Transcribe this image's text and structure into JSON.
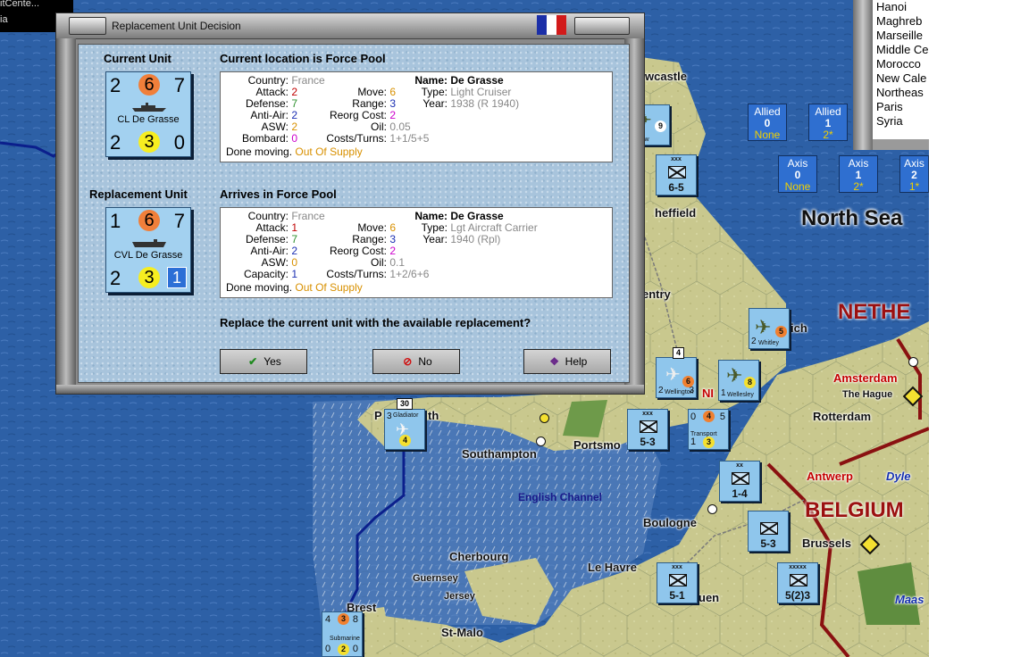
{
  "top_left": {
    "line1": "itCente...",
    "line2": "ia"
  },
  "right_list": {
    "items": [
      "Hanoi",
      "Maghreb",
      "Marseille",
      "Middle Ce",
      "Morocco",
      "New Cale",
      "Northeas",
      "Paris",
      "Syria"
    ]
  },
  "supply_boxes": [
    {
      "title": "Allied",
      "value": "0",
      "sub": "None"
    },
    {
      "title": "Allied",
      "value": "1",
      "sub": "2*"
    },
    {
      "title": "Axis",
      "value": "0",
      "sub": "None"
    },
    {
      "title": "Axis",
      "value": "1",
      "sub": "2*"
    },
    {
      "title": "Axis",
      "value": "2",
      "sub": "1*"
    }
  ],
  "map_labels": {
    "newcastle": "wcastle",
    "sheffield": "heffield",
    "coventry": "entry",
    "north_sea": "North Sea",
    "netherlands": "NETHE",
    "norwich": "ich",
    "amsterdam": "Amsterdam",
    "the_hague": "The Hague",
    "rotterdam": "Rotterdam",
    "plymouth_a": "P",
    "plymouth_b": "th",
    "southampton": "Southampton",
    "portsmouth": "Portsmo",
    "english_channel": "English Channel",
    "antwerp": "Antwerp",
    "dyle": "Dyle",
    "belgium": "BELGIUM",
    "boulogne": "Boulogne",
    "brussels": "Brussels",
    "cherbourg": "Cherbourg",
    "guernsey": "Guernsey",
    "jersey": "Jersey",
    "le_havre": "Le Havre",
    "rouen": "uen",
    "brest": "Brest",
    "st_malo": "St-Malo",
    "maas": "Maas",
    "ni": "NI"
  },
  "map_counters": [
    {
      "id": "c1",
      "top": "xxx",
      "val": "6-5"
    },
    {
      "id": "c2",
      "top": "xxx",
      "val": "5-3"
    },
    {
      "id": "c3",
      "top": "xx",
      "val": "1-4"
    },
    {
      "id": "c4",
      "top": "",
      "val": "5-3"
    },
    {
      "id": "c5",
      "top": "xxx",
      "val": "5-1"
    },
    {
      "id": "c6",
      "top": "xxxxx",
      "val": "5(2)3"
    }
  ],
  "map_air": {
    "whitley_name": "Whitley",
    "whitley_a": "2",
    "whitley_b": "5",
    "wellington_name": "Wellington",
    "wellington_a": "2",
    "wellington_b": "6",
    "wellington_c": "3",
    "wellesley_name": "Wellesley",
    "wellesley_a": "1",
    "wellesley_b": "8",
    "gladiator_name": "Gladiator",
    "gladiator_a": "3",
    "gladiator_b": "4",
    "arrow_name": "rrow",
    "arrow_b": "9",
    "stack4": "4",
    "stack30": "30"
  },
  "transport": {
    "name": "Transport",
    "a": "0",
    "b": "4",
    "c": "5",
    "d": "1",
    "e": "3"
  },
  "submarine": {
    "name": "Submarine",
    "a": "4",
    "b": "3",
    "c": "8",
    "d": "0",
    "e": "2",
    "f": "0"
  },
  "dialog": {
    "title": "Replacement Unit Decision",
    "current_header": "Current Unit",
    "current_location": "Current location is Force Pool",
    "replacement_header": "Replacement Unit",
    "arrives": "Arrives in Force Pool",
    "question": "Replace the current unit with the available replacement?",
    "buttons": {
      "yes": "Yes",
      "no": "No",
      "help": "Help"
    },
    "current_unit": {
      "attack": "2",
      "move": "6",
      "range": "7",
      "name": "CL De Grasse",
      "aa": "2",
      "def": "3",
      "cost": "0"
    },
    "replacement_unit": {
      "attack": "1",
      "move": "6",
      "range": "7",
      "name": "CVL De Grasse",
      "aa": "2",
      "def": "3",
      "cap": "1"
    },
    "current_info": {
      "country_label": "Country:",
      "country": "France",
      "attack_label": "Attack:",
      "attack": "2",
      "defense_label": "Defense:",
      "defense": "7",
      "aa_label": "Anti-Air:",
      "aa": "2",
      "asw_label": "ASW:",
      "asw": "2",
      "bombard_label": "Bombard:",
      "bombard": "0",
      "done_label": "Done moving.",
      "supply": "Out Of Supply",
      "move_label": "Move:",
      "move": "6",
      "range_label": "Range:",
      "range": "3",
      "reorg_label": "Reorg Cost:",
      "reorg": "2",
      "oil_label": "Oil:",
      "oil": "0.05",
      "costs_label": "Costs/Turns:",
      "costs": "1+1/5+5",
      "name_label": "Name:",
      "name": "De Grasse",
      "type_label": "Type:",
      "type": "Light Cruiser",
      "year_label": "Year:",
      "year": "1938 (R 1940)"
    },
    "replacement_info": {
      "country_label": "Country:",
      "country": "France",
      "attack_label": "Attack:",
      "attack": "1",
      "defense_label": "Defense:",
      "defense": "7",
      "aa_label": "Anti-Air:",
      "aa": "2",
      "asw_label": "ASW:",
      "asw": "0",
      "capacity_label": "Capacity:",
      "capacity": "1",
      "done_label": "Done moving.",
      "supply": "Out Of Supply",
      "move_label": "Move:",
      "move": "6",
      "range_label": "Range:",
      "range": "3",
      "reorg_label": "Reorg Cost:",
      "reorg": "2",
      "oil_label": "Oil:",
      "oil": "0.1",
      "costs_label": "Costs/Turns:",
      "costs": "1+2/6+6",
      "name_label": "Name:",
      "name": "De Grasse",
      "type_label": "Type:",
      "type": "Lgt Aircraft Carrier",
      "year_label": "Year:",
      "year": "1940 (Rpl)"
    }
  },
  "colors": {
    "sea": "#2a5da3",
    "land": "#c7c98f",
    "counter": "#8fc6ec",
    "dialog_bg": "#a8c4dc"
  }
}
